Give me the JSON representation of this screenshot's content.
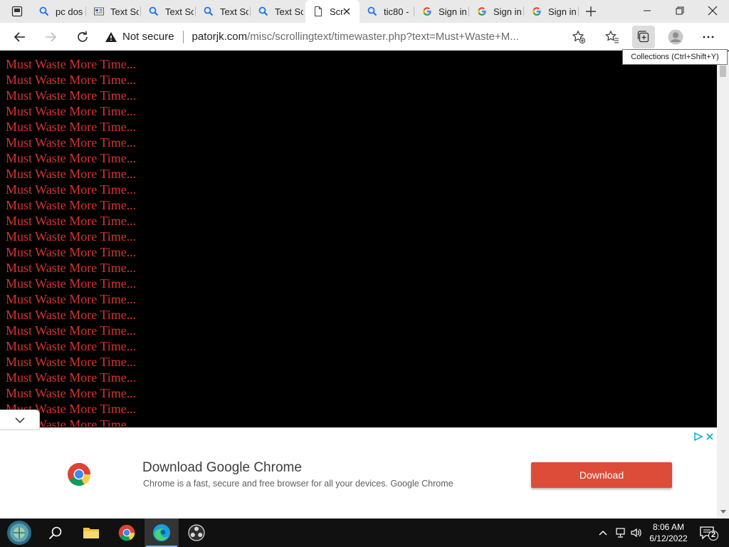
{
  "browser": {
    "tabs": [
      {
        "title": "pc dos",
        "favicon": "search-icon"
      },
      {
        "title": "Text Sc",
        "favicon": "newspaper-icon"
      },
      {
        "title": "Text Sc",
        "favicon": "search-icon"
      },
      {
        "title": "Text Sc",
        "favicon": "search-icon"
      },
      {
        "title": "Text Sc",
        "favicon": "search-icon"
      },
      {
        "title": "Scr",
        "favicon": "page-icon",
        "active": true
      },
      {
        "title": "tic80 -",
        "favicon": "search-icon"
      },
      {
        "title": "Sign in",
        "favicon": "google-icon"
      },
      {
        "title": "Sign in",
        "favicon": "google-icon"
      },
      {
        "title": "Sign in",
        "favicon": "google-icon"
      }
    ],
    "address": {
      "security_label": "Not secure",
      "url_host": "patorjk.com",
      "url_path": "/misc/scrollingtext/timewaster.php?text=Must+Waste+M..."
    },
    "tooltip": "Collections (Ctrl+Shift+Y)"
  },
  "page": {
    "line_text": "Must Waste More Time...",
    "line_count": 24,
    "text_color": "#d9322e",
    "background_color": "#000000"
  },
  "ad": {
    "title": "Download Google Chrome",
    "description": "Chrome is a fast, secure and free browser for all your devices. Google Chrome",
    "button_label": "Download",
    "button_color": "#dd4b39"
  },
  "taskbar": {
    "apps": [
      "start-icon",
      "search-icon",
      "file-explorer-icon",
      "chrome-icon",
      "edge-icon",
      "obs-icon"
    ],
    "time": "8:06 AM",
    "date": "6/12/2022",
    "notification_count": "2"
  }
}
